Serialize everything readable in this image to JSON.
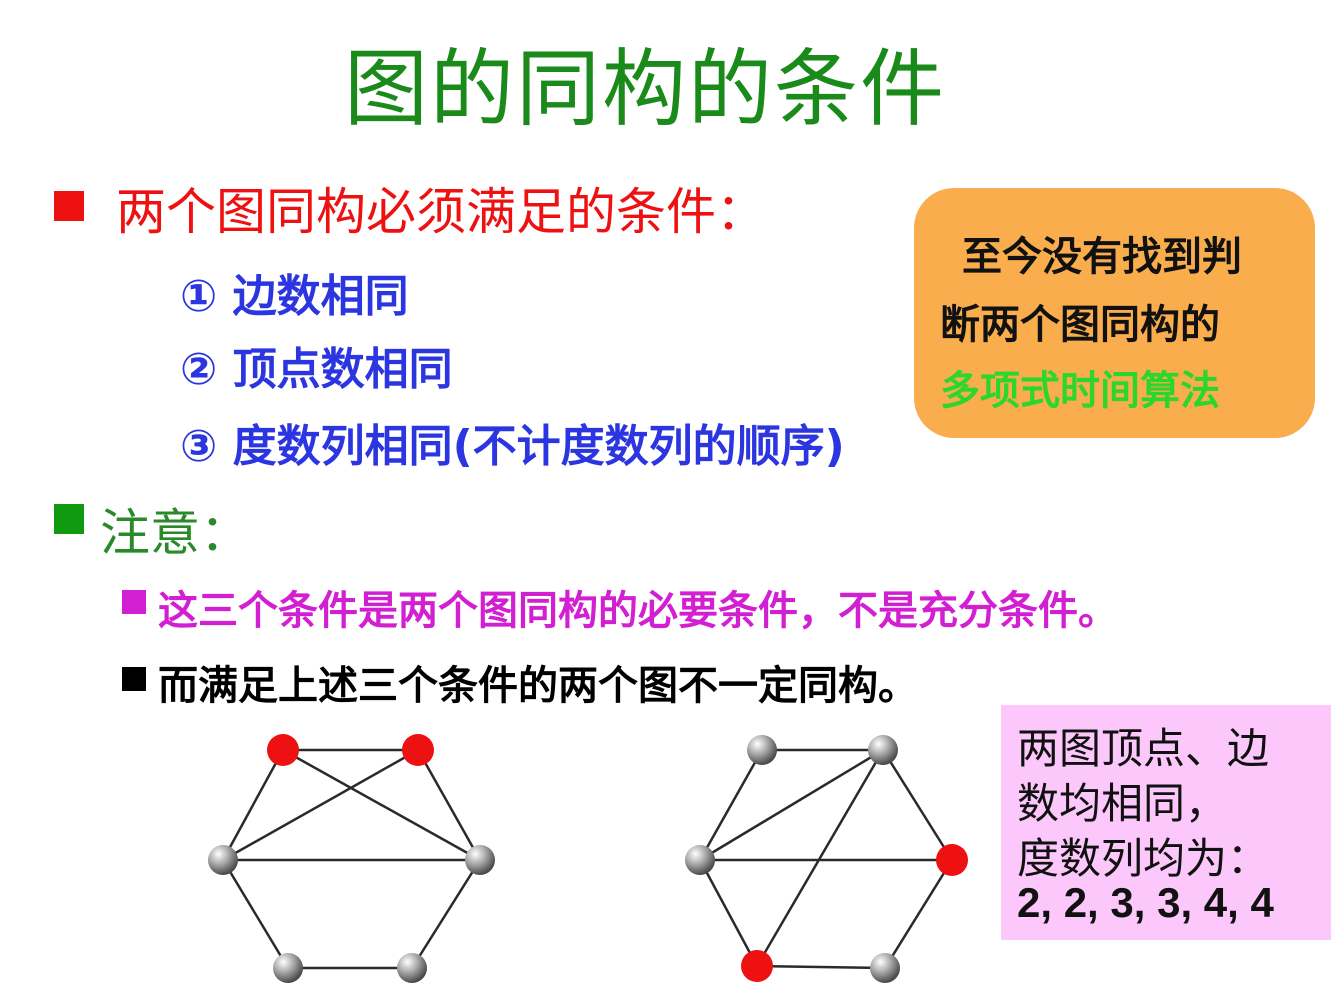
{
  "slide": {
    "title": "图的同构的条件",
    "bullet1": {
      "text": "两个图同构必须满足的条件：",
      "items": [
        "① 边数相同",
        "② 顶点数相同",
        "③ 度数列相同(不计度数列的顺序)"
      ]
    },
    "bullet2": {
      "text": "注意：",
      "sub": [
        "这三个条件是两个图同构的必要条件，不是充分条件。",
        "而满足上述三个条件的两个图不一定同构。"
      ]
    },
    "callout": {
      "line1": "至今没有找到判",
      "line2": "断两个图同构的",
      "line3": "多项式时间算法"
    },
    "note": {
      "line1": "两图顶点、边",
      "line2": "数均相同，",
      "line3": "度数列均为：",
      "line4": "2, 2, 3, 3, 4, 4"
    }
  },
  "colors": {
    "title": "#1a8a1a",
    "red": "#ee1111",
    "blue": "#2b35e0",
    "magenta": "#d21fd2",
    "callout_bg": "#f9ad4c",
    "callout_green": "#2cd62c",
    "note_bg": "#fcc7fa",
    "vertex_highlight": "#ee1111",
    "vertex_normal": "#9a9a9a"
  }
}
